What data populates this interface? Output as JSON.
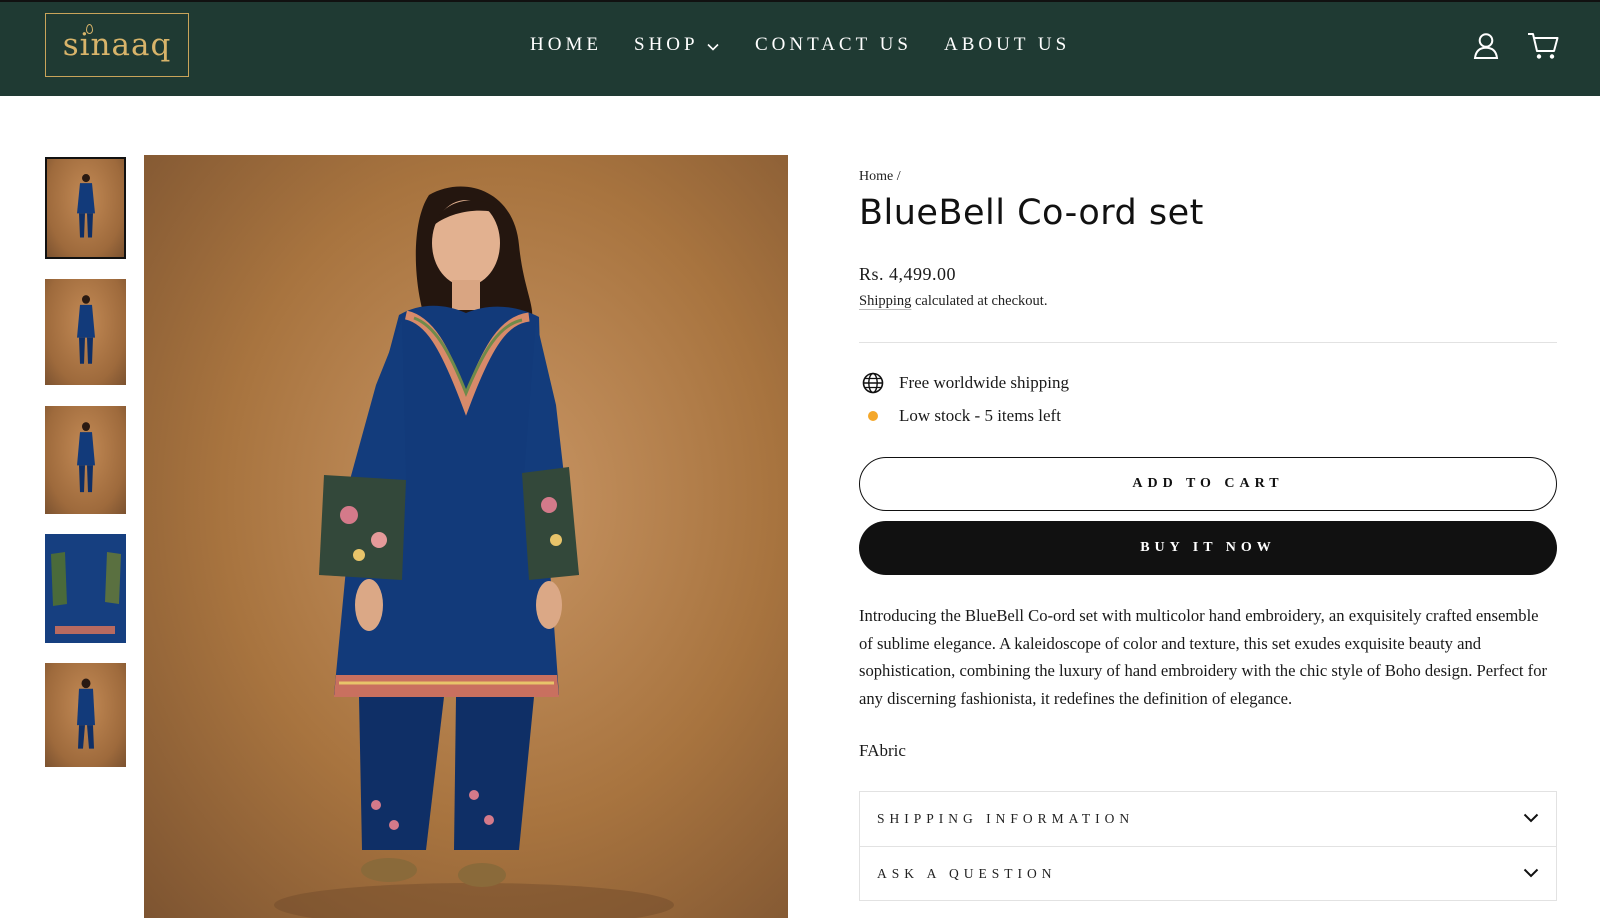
{
  "brand": {
    "logo_text": "sinaaq"
  },
  "nav": {
    "items": [
      {
        "label": "HOME"
      },
      {
        "label": "SHOP"
      },
      {
        "label": "CONTACT US"
      },
      {
        "label": "ABOUT US"
      }
    ],
    "icons": [
      "user-icon",
      "cart-icon"
    ]
  },
  "product": {
    "breadcrumb": {
      "home": "Home",
      "separator": "/"
    },
    "title": "BlueBell Co-ord set",
    "price": "Rs. 4,499.00",
    "shipping_link": "Shipping",
    "shipping_note": " calculated at checkout.",
    "features": [
      {
        "icon": "globe-icon",
        "text": "Free worldwide shipping"
      },
      {
        "icon": "low-stock-dot",
        "text": "Low stock - 5 items left"
      }
    ],
    "add_to_cart": "ADD TO CART",
    "buy_now": "BUY IT NOW",
    "description": "Introducing the BlueBell Co-ord set with multicolor hand embroidery, an exquisitely crafted ensemble of sublime elegance. A kaleidoscope of color and texture, this set exudes exquisite beauty and sophistication, combining the luxury of hand embroidery with the chic style of Boho design. Perfect for any discerning fashionista, it redefines the definition of elegance.",
    "fabric_label": "FAbric",
    "accordion": [
      {
        "label": "SHIPPING INFORMATION"
      },
      {
        "label": "ASK A QUESTION"
      }
    ]
  },
  "gallery": {
    "thumbnail_count": 5
  },
  "colors": {
    "header_bg": "#1f3a33",
    "logo_gold": "#d8b46a",
    "button_dark": "#111111",
    "stock_dot": "#f4a72a",
    "outfit_blue": "#123a7a"
  }
}
